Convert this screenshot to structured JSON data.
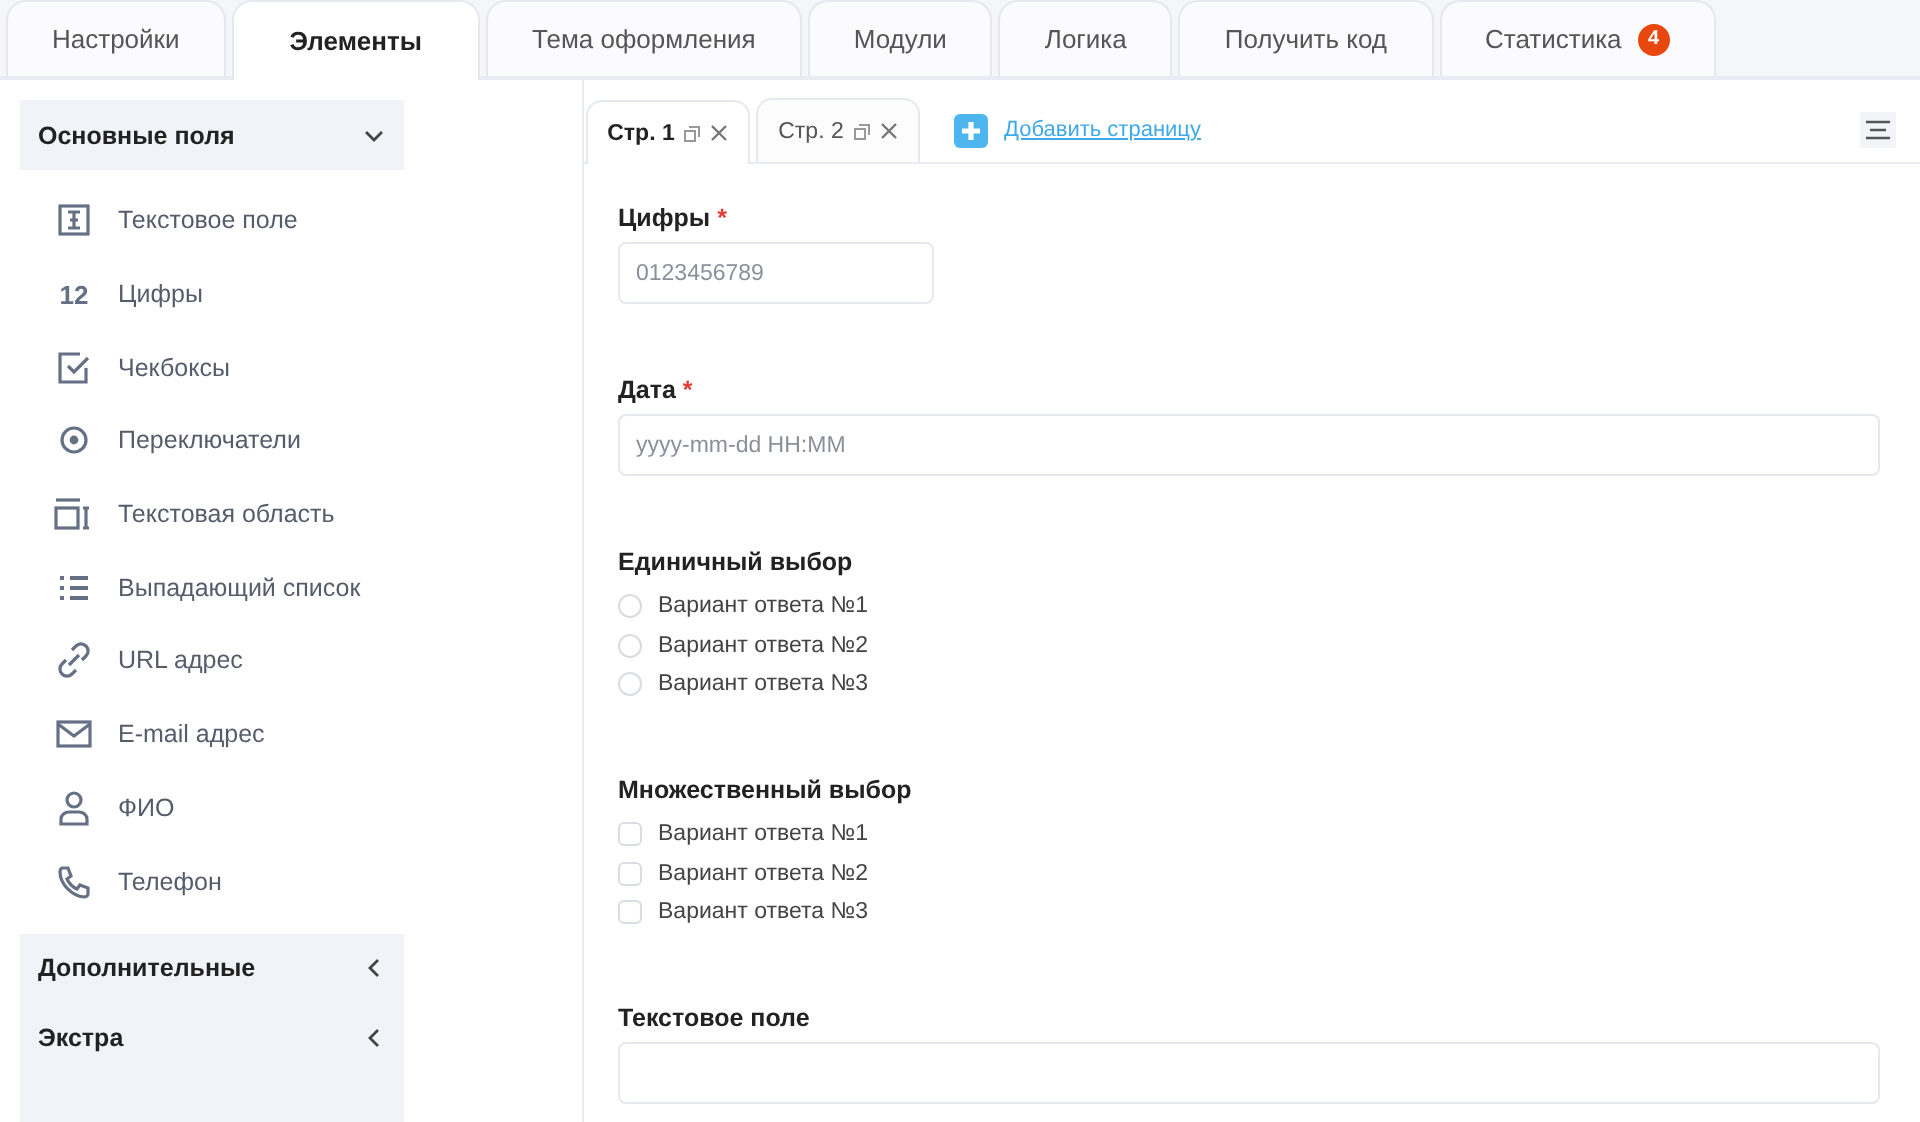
{
  "tabs": [
    {
      "label": "Настройки",
      "selected": false
    },
    {
      "label": "Элементы",
      "selected": true
    },
    {
      "label": "Тема оформления",
      "selected": false
    },
    {
      "label": "Модули",
      "selected": false
    },
    {
      "label": "Логика",
      "selected": false
    },
    {
      "label": "Получить код",
      "selected": false
    },
    {
      "label": "Статистика",
      "selected": false,
      "badge": "4"
    }
  ],
  "sidebar": {
    "sections": [
      {
        "title": "Основные поля",
        "expanded": true,
        "items": [
          {
            "label": "Текстовое поле"
          },
          {
            "label": "Цифры",
            "icon_text": "12"
          },
          {
            "label": "Чекбоксы"
          },
          {
            "label": "Переключатели"
          },
          {
            "label": "Текстовая область"
          },
          {
            "label": "Выпадающий список"
          },
          {
            "label": "URL адрес"
          },
          {
            "label": "E-mail адрес"
          },
          {
            "label": "ФИО"
          },
          {
            "label": "Телефон"
          }
        ]
      },
      {
        "title": "Дополнительные",
        "expanded": false
      },
      {
        "title": "Экстра",
        "expanded": false
      }
    ]
  },
  "pages": [
    {
      "label": "Стр. 1",
      "selected": true
    },
    {
      "label": "Стр. 2",
      "selected": false
    }
  ],
  "add_page": "Добавить страницу",
  "fields": [
    {
      "kind": "compact",
      "label": "Цифры",
      "required_mark": "*",
      "placeholder": "0123456789"
    },
    {
      "kind": "input",
      "label": "Дата",
      "required_mark": "*",
      "placeholder": "yyyy-mm-dd HH:MM"
    },
    {
      "kind": "radio",
      "label": "Единичный выбор",
      "options": [
        {
          "label": "Вариант ответа №1",
          "checked": false
        },
        {
          "label": "Вариант ответа №2",
          "checked": false
        },
        {
          "label": "Вариант ответа №3",
          "checked": false
        }
      ]
    },
    {
      "kind": "checkbox",
      "label": "Множественный выбор",
      "options": [
        {
          "label": "Вариант ответа №1",
          "checked": false
        },
        {
          "label": "Вариант ответа №2",
          "checked": false
        },
        {
          "label": "Вариант ответа №3",
          "checked": false
        }
      ]
    },
    {
      "kind": "input",
      "label": "Текстовое поле"
    }
  ]
}
